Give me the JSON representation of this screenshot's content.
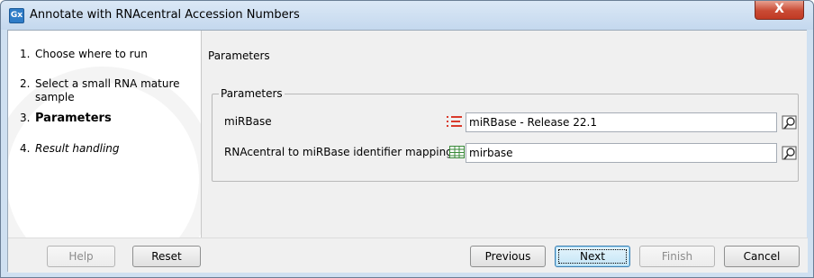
{
  "window": {
    "title": "Annotate with RNAcentral Accession Numbers",
    "app_icon_text": "Gx",
    "close_label": "X"
  },
  "steps": [
    {
      "number": "1.",
      "label": "Choose where to run",
      "state": "normal"
    },
    {
      "number": "2.",
      "label": "Select a small RNA mature sample",
      "state": "normal"
    },
    {
      "number": "3.",
      "label": "Parameters",
      "state": "active"
    },
    {
      "number": "4.",
      "label": "Result handling",
      "state": "future"
    }
  ],
  "main": {
    "heading": "Parameters",
    "group_title": "Parameters",
    "params": [
      {
        "label": "miRBase",
        "icon": "list-lines-icon",
        "value": "miRBase - Release 22.1"
      },
      {
        "label": "RNAcentral to miRBase identifier mappings",
        "icon": "table-icon",
        "value": "mirbase"
      }
    ]
  },
  "footer": {
    "help": "Help",
    "reset": "Reset",
    "previous": "Previous",
    "next": "Next",
    "finish": "Finish",
    "cancel": "Cancel"
  },
  "colors": {
    "title_bar": "#c4d8ee",
    "close_button": "#c94a34",
    "list_icon": "#d93a2b",
    "table_icon": "#3a8a3a"
  }
}
